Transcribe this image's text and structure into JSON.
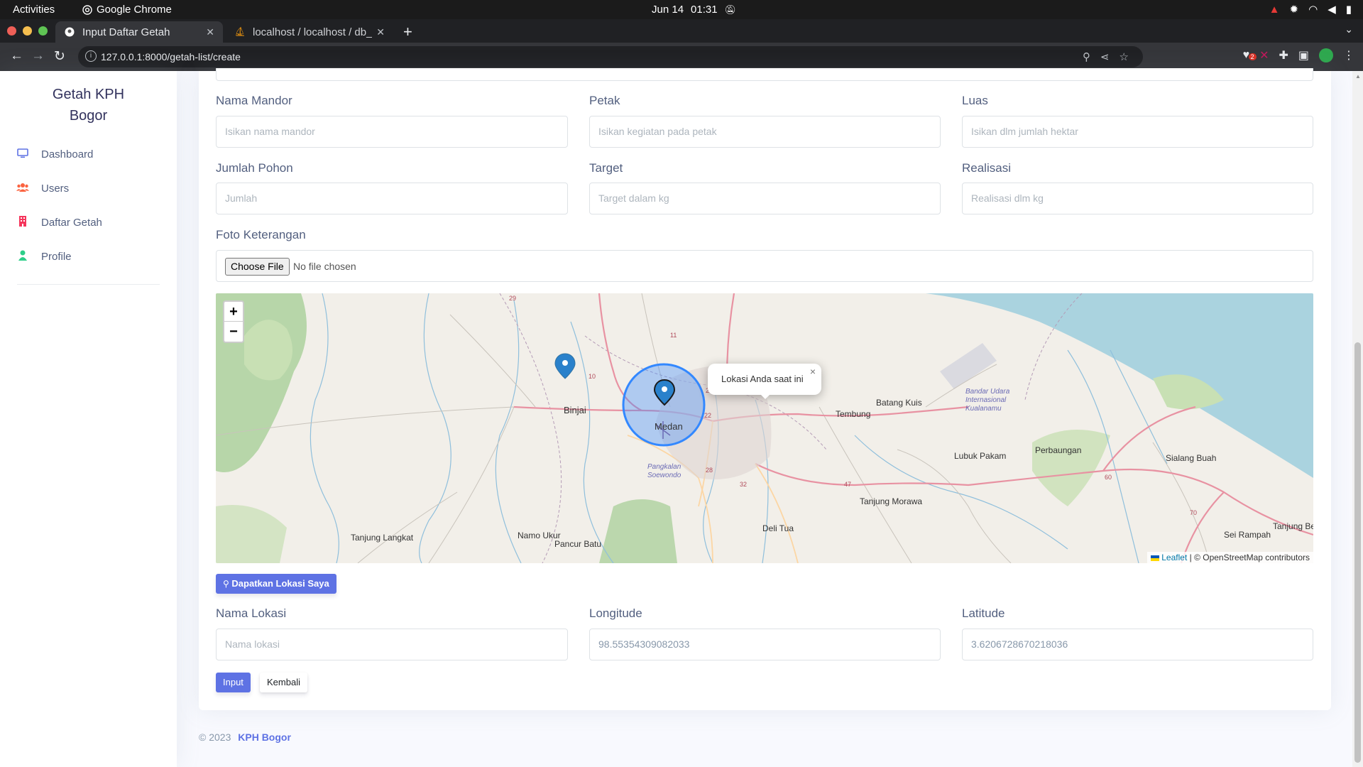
{
  "os": {
    "activities": "Activities",
    "app_name": "Google Chrome",
    "date": "Jun 14",
    "time": "01:31"
  },
  "browser": {
    "tabs": [
      {
        "title": "Input Daftar Getah",
        "active": true
      },
      {
        "title": "localhost / localhost / db_",
        "active": false
      }
    ],
    "url": "127.0.0.1:8000/getah-list/create",
    "extension_badge": "2"
  },
  "sidebar": {
    "brand_line1": "Getah KPH",
    "brand_line2": "Bogor",
    "items": [
      {
        "label": "Dashboard",
        "icon": "tv-icon",
        "color": "#5e72e4"
      },
      {
        "label": "Users",
        "icon": "users-icon",
        "color": "#fb6340"
      },
      {
        "label": "Daftar Getah",
        "icon": "building-icon",
        "color": "#f5365c"
      },
      {
        "label": "Profile",
        "icon": "user-icon",
        "color": "#2dce89"
      }
    ]
  },
  "form": {
    "nama_mandor": {
      "label": "Nama Mandor",
      "placeholder": "Isikan nama mandor"
    },
    "petak": {
      "label": "Petak",
      "placeholder": "Isikan kegiatan pada petak"
    },
    "luas": {
      "label": "Luas",
      "placeholder": "Isikan dlm jumlah hektar"
    },
    "jumlah_pohon": {
      "label": "Jumlah Pohon",
      "placeholder": "Jumlah"
    },
    "target": {
      "label": "Target",
      "placeholder": "Target dalam kg"
    },
    "realisasi": {
      "label": "Realisasi",
      "placeholder": "Realisasi dlm kg"
    },
    "foto": {
      "label": "Foto Keterangan",
      "button": "Choose File",
      "status": "No file chosen"
    },
    "locate_button": "Dapatkan Lokasi Saya",
    "nama_lokasi": {
      "label": "Nama Lokasi",
      "placeholder": "Nama lokasi"
    },
    "longitude": {
      "label": "Longitude",
      "value": "98.55354309082033"
    },
    "latitude": {
      "label": "Latitude",
      "value": "3.6206728670218036"
    },
    "submit_label": "Input",
    "back_label": "Kembali"
  },
  "map": {
    "zoom_in": "+",
    "zoom_out": "−",
    "popup_text": "Lokasi Anda saat ini",
    "popup_close": "×",
    "attribution_link": "Leaflet",
    "attribution_text": "| © OpenStreetMap contributors",
    "places": [
      "Binjai",
      "Medan",
      "Batang Kuis",
      "Tembung",
      "Lubuk Pakam",
      "Perbaungan",
      "Sialang Buah",
      "Tanjung Morawa",
      "Deli Tua",
      "Pancur Batu",
      "Namo Ukur",
      "Tanjung Langkat",
      "Sei Rampah",
      "Tanjung Be",
      "Bandar Udara Internasional Kualanamu",
      "Pangkalan Soewondo"
    ],
    "road_numbers": [
      "29",
      "10",
      "11",
      "22",
      "22",
      "28",
      "32",
      "47",
      "60",
      "70"
    ]
  },
  "footer": {
    "copyright": "© 2023",
    "brand": "KPH Bogor"
  }
}
